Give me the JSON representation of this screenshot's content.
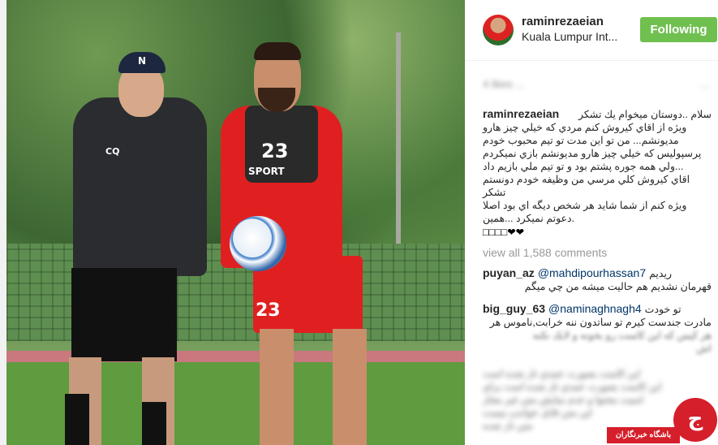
{
  "post": {
    "author": {
      "username": "raminrezaeian",
      "location": "Kuala Lumpur Int...",
      "follow_label": "Following",
      "follow_color": "#70c050"
    },
    "photo": {
      "coach_chest_initials": "CQ",
      "coach_cap_letter": "N",
      "player_number": "23",
      "player_sponsor": "SPORT",
      "shorts_number": "23"
    },
    "likes_blurred": "4 likes ...",
    "caption": {
      "username": "raminrezaeian",
      "lines": [
        "سلام ..دوستان ميخوام يك تشكر",
        "ويژه از اقاي كيروش كنم مردي كه خيلي چيز هارو",
        "مديونشم... من تو اين مدت تو تيم محبوب خودم",
        "پرسپوليس كه خيلي چيز هارو مديونشم بازي نميكردم",
        "...ولي همه جوره پشتم بود و تو تيم ملي بازيم داد",
        "اقاي كيروش كلي مرسي من وظيفه خودم دونستم تشكر",
        "ويژه كنم از شما شايد هر شخص ديگه اي بود اصلا",
        ".دعوتم نميكرد ...همين"
      ],
      "emoji_line": "□□□□❤❤"
    },
    "view_all": "view all 1,588 comments",
    "comments": [
      {
        "username": "puyan_az",
        "mention": "@mahdipourhassan7",
        "text": "ريديم",
        "line2": "قهرمان نشديم هم حاليت ميشه من چي ميگم"
      },
      {
        "username": "big_guy_63",
        "mention": "@naminaghnagh4",
        "text": "تو خودت",
        "line2": "مادرت جندست كيرم تو ساتدون ننه خرابت,ناموس هر",
        "line3": "هر كيس كه اين كامنت رو بخونه و لايك نكنه",
        "line4": "اش"
      }
    ],
    "blurred_comment_lines": [
      "اين كامنت بصورت عمدي تار شده است",
      "اين كامنت بصورت عمدي تار شده است براي",
      "امنيت محتوا و عدم نمايش متن غير مجاز",
      "اين متن قابل خواندن نيست",
      "متن تار شده"
    ]
  },
  "watermark": {
    "label": "باشگاه خبرنگاران",
    "logo_glyph": "ج",
    "color": "#d51f2a"
  }
}
